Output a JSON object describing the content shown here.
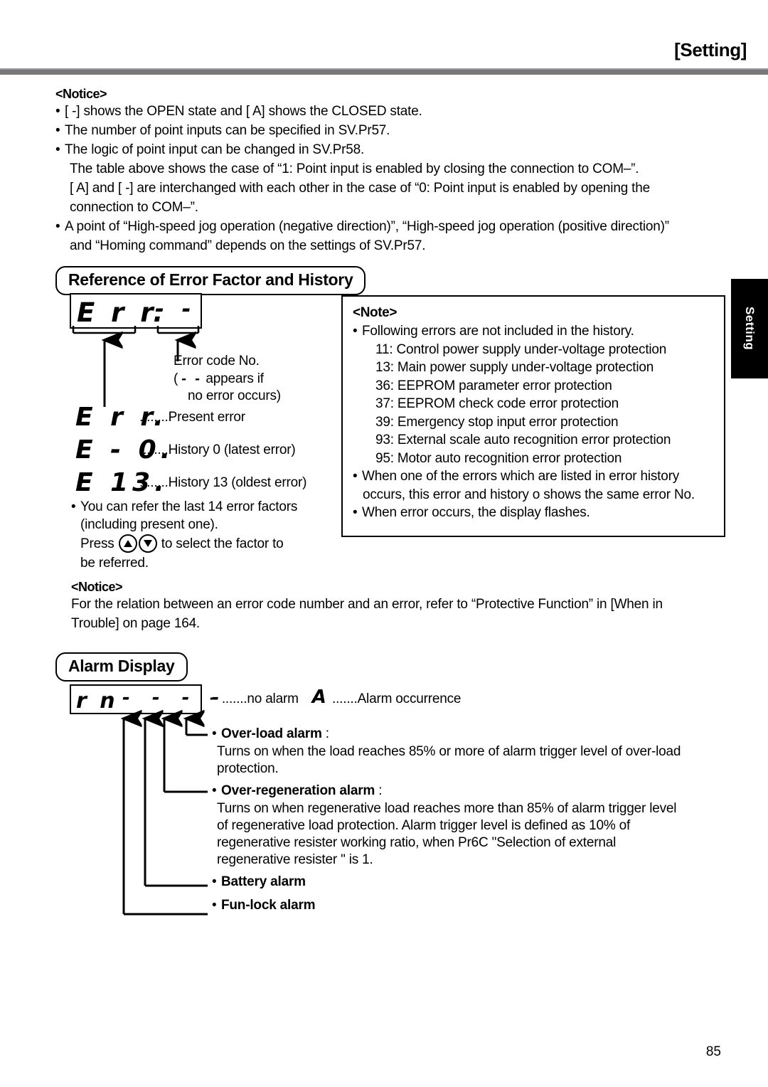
{
  "header": {
    "title": "[Setting]",
    "side_tab": "Setting"
  },
  "page_number": "85",
  "notice_top": {
    "label": "<Notice>",
    "lines": [
      {
        "bullet": true,
        "text": "[  -]   shows the OPEN state and [  A]   shows the CLOSED state."
      },
      {
        "bullet": true,
        "text": "The number of point inputs can be specified in SV.Pr57."
      },
      {
        "bullet": true,
        "text": "The logic of point input can be changed in SV.Pr58."
      },
      {
        "bullet": false,
        "text": "The table above shows the case of “1: Point input is enabled by closing the connection to COM–”."
      },
      {
        "bullet": false,
        "text": "[  A]   and [  -]   are interchanged with each other in the case of “0: Point input is enabled by opening the"
      },
      {
        "bullet": false,
        "text": "connection to COM–”."
      },
      {
        "bullet": true,
        "text": "A point of “High-speed jog operation (negative direction)”, “High-speed jog operation (positive direction)”"
      },
      {
        "bullet": false,
        "text": "and “Homing command” depends on the settings of SV.Pr57."
      }
    ]
  },
  "section_error": {
    "heading": "Reference of Error Factor and History",
    "display_box": {
      "left_digits": "Err.",
      "right_digits": "- -"
    },
    "callout": {
      "line1": "Error code No.",
      "line2_prefix": "(",
      "line2_dashes": "-  -",
      "line2_suffix": "appears if",
      "line3": "no error occurs)"
    },
    "rows": [
      {
        "display": "Err.",
        "dots": "........",
        "label": "Present error"
      },
      {
        "display": "E - 0.",
        "dots": "........",
        "label": "History 0 (latest error)"
      },
      {
        "display": "E 13.",
        "dots": "........",
        "label": "History 13 (oldest error)"
      }
    ],
    "notes_below": {
      "line1": "You can refer the last 14 error factors",
      "line2": "(including present one).",
      "line3_prefix": "Press",
      "line3_suffix": "to select the factor to",
      "line4": "be referred.",
      "key_up": "up-arrow-key",
      "key_down": "down-arrow-key"
    }
  },
  "note_box": {
    "heading": "<Note>",
    "intro": "Following errors are not included in the history.",
    "error_codes": [
      {
        "code": "11:",
        "desc": "Control power supply under-voltage protection"
      },
      {
        "code": "13:",
        "desc": "Main power supply under-voltage protection"
      },
      {
        "code": "36:",
        "desc": "EEPROM parameter error protection"
      },
      {
        "code": "37:",
        "desc": "EEPROM check code error protection"
      },
      {
        "code": "39:",
        "desc": "Emergency stop input error protection"
      },
      {
        "code": "93:",
        "desc": "External scale auto recognition error protection"
      },
      {
        "code": "95:",
        "desc": "Motor auto recognition error protection"
      }
    ],
    "bullets": [
      {
        "l1": "When one of the errors which are listed in error history",
        "l2": "occurs, this error and history o shows the same error No."
      },
      {
        "l1": "When error occurs, the display flashes.",
        "l2": ""
      }
    ]
  },
  "notice_bottom": {
    "label": "<Notice>",
    "line1": "For the relation between an error code number and an error, refer to “Protective Function” in [When in",
    "line2": "Trouble] on page 164."
  },
  "section_alarm": {
    "heading": "Alarm Display",
    "display_digits": "r n - - - -",
    "legend": {
      "no_alarm_glyph": "-",
      "no_alarm_dots": ".......",
      "no_alarm_text": "no alarm",
      "alarm_glyph": "A",
      "alarm_dots": ".......",
      "alarm_text": "Alarm occurrence"
    },
    "items": [
      {
        "title": "Over-load alarm",
        "colon": ":",
        "desc_lines": [
          "Turns on when the load reaches 85% or more of alarm trigger level of over-load",
          "protection."
        ]
      },
      {
        "title": "Over-regeneration alarm",
        "colon": ":",
        "desc_lines": [
          "Turns on when regenerative load reaches more than 85% of alarm trigger level",
          "of regenerative load protection. Alarm trigger level is defined as 10% of",
          "regenerative resister working ratio, when Pr6C \"Selection of external",
          "regenerative resister \" is 1."
        ]
      },
      {
        "title": "Battery alarm",
        "colon": "",
        "desc_lines": []
      },
      {
        "title": "Fun-lock alarm",
        "colon": "",
        "desc_lines": []
      }
    ]
  }
}
